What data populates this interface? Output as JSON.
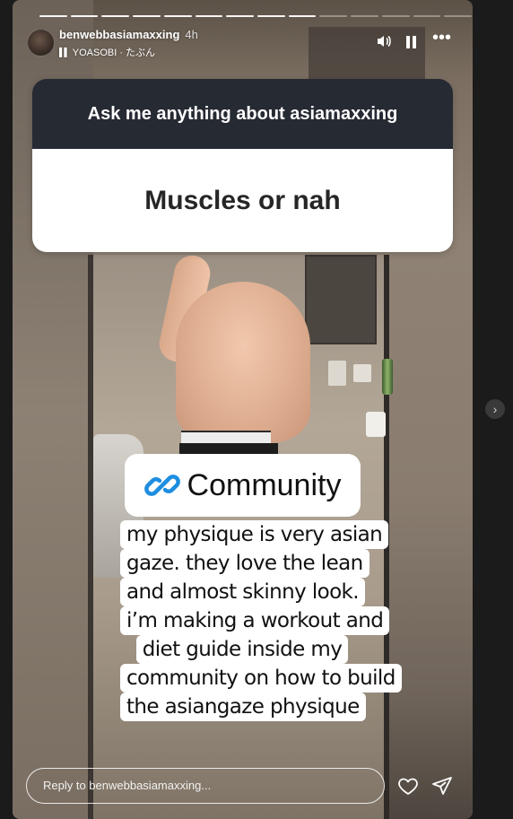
{
  "story": {
    "progress": {
      "total": 14,
      "completed": 9
    },
    "header": {
      "username": "benwebbasiamaxxing",
      "time": "4h",
      "music": "YOASOBI · たぶん",
      "sound_icon": "speaker-icon",
      "pause_icon": "pause-icon",
      "more_icon": "more-dots-icon"
    },
    "question": {
      "prompt": "Ask me anything about asiamaxxing",
      "answer": "Muscles or nah"
    },
    "link_sticker": {
      "label": "Community",
      "icon": "link-icon",
      "accent": "#1e8ee0"
    },
    "caption": [
      "my physique is very asian",
      "gaze. they love the lean",
      "and almost skinny look.",
      "i’m making a workout and",
      "diet guide inside my",
      "community on how to build",
      "the asiangaze physique"
    ],
    "reply": {
      "placeholder": "Reply to benwebbasiamaxxing..."
    },
    "actions": {
      "like_icon": "heart-icon",
      "share_icon": "send-icon"
    }
  },
  "nav": {
    "next_icon": "chevron-right-icon"
  }
}
